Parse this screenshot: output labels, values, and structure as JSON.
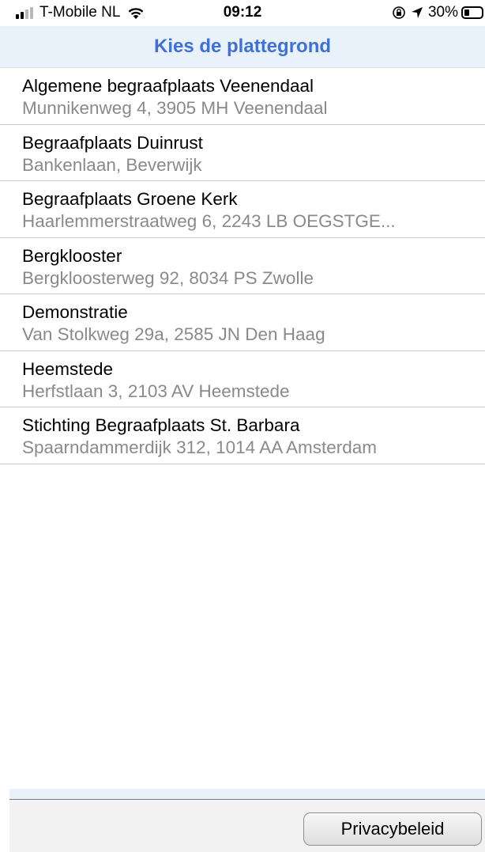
{
  "status_bar": {
    "carrier": "T-Mobile NL",
    "time": "09:12",
    "battery_percent": "30%",
    "battery_level": 0.3,
    "icons": [
      "signal-icon",
      "wifi-icon",
      "rotation-lock-icon",
      "location-arrow-icon",
      "battery-icon"
    ]
  },
  "header": {
    "title": "Kies de plattegrond"
  },
  "locations": [
    {
      "name": "Algemene begraafplaats Veenendaal",
      "address": "Munnikenweg 4, 3905 MH Veenendaal"
    },
    {
      "name": "Begraafplaats Duinrust",
      "address": "Bankenlaan, Beverwijk"
    },
    {
      "name": "Begraafplaats Groene Kerk",
      "address": "Haarlemmerstraatweg 6, 2243 LB OEGSTGE..."
    },
    {
      "name": "Bergklooster",
      "address": "Bergkloosterweg 92, 8034 PS Zwolle"
    },
    {
      "name": "Demonstratie",
      "address": "Van Stolkweg 29a, 2585 JN  Den Haag"
    },
    {
      "name": "Heemstede",
      "address": "Herfstlaan 3, 2103 AV Heemstede"
    },
    {
      "name": "Stichting Begraafplaats St. Barbara",
      "address": "Spaarndammerdijk 312, 1014 AA Amsterdam"
    }
  ],
  "toolbar": {
    "privacy_label": "Privacybeleid"
  },
  "colors": {
    "accent": "#3f6fd8",
    "header_bg": "#e9f1fb",
    "secondary_text": "#8a8a8e"
  }
}
